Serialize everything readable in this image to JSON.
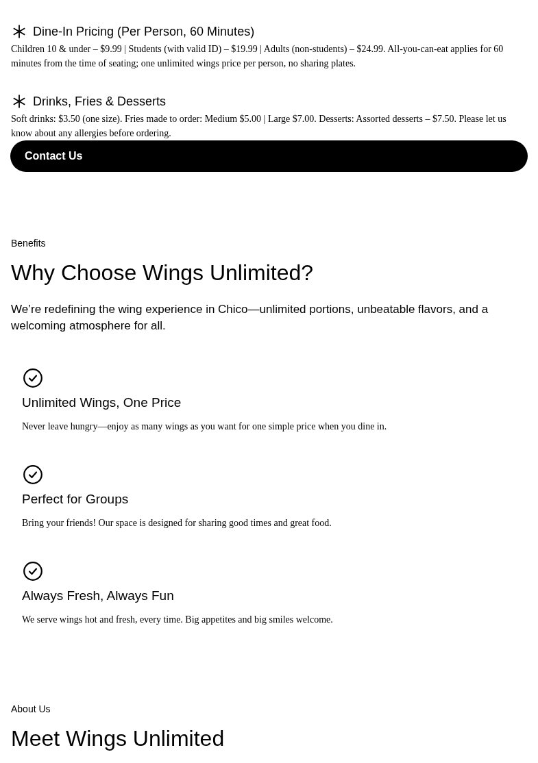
{
  "pricing_items": [
    {
      "title": "Dine-In Pricing (Per Person, 60 Minutes)",
      "text": "Children 10 & under – $9.99 | Students (with valid ID) – $19.99 | Adults (non-students) – $24.99. All-you-can-eat applies for 60 minutes from the time of seating; one unlimited wings price per person, no sharing plates."
    },
    {
      "title": "Drinks, Fries & Desserts",
      "text": "Soft drinks: $3.50 (one size). Fries made to order: Medium $5.00 | Large $7.00. Desserts: Assorted desserts – $7.50. Please let us know about any allergies before ordering."
    }
  ],
  "contact_button": "Contact Us",
  "benefits": {
    "eyebrow": "Benefits",
    "heading": "Why Choose Wings Unlimited?",
    "intro": "We’re redefining the wing experience in Chico—unlimited portions, unbeatable flavors, and a welcoming atmosphere for all.",
    "features": [
      {
        "title": "Unlimited Wings, One Price",
        "text": "Never leave hungry—enjoy as many wings as you want for one simple price when you dine in."
      },
      {
        "title": "Perfect for Groups",
        "text": "Bring your friends! Our space is designed for sharing good times and great food."
      },
      {
        "title": "Always Fresh, Always Fun",
        "text": "We serve wings hot and fresh, every time. Big appetites and big smiles welcome."
      }
    ]
  },
  "about": {
    "eyebrow": "About Us",
    "heading": "Meet Wings Unlimited"
  }
}
